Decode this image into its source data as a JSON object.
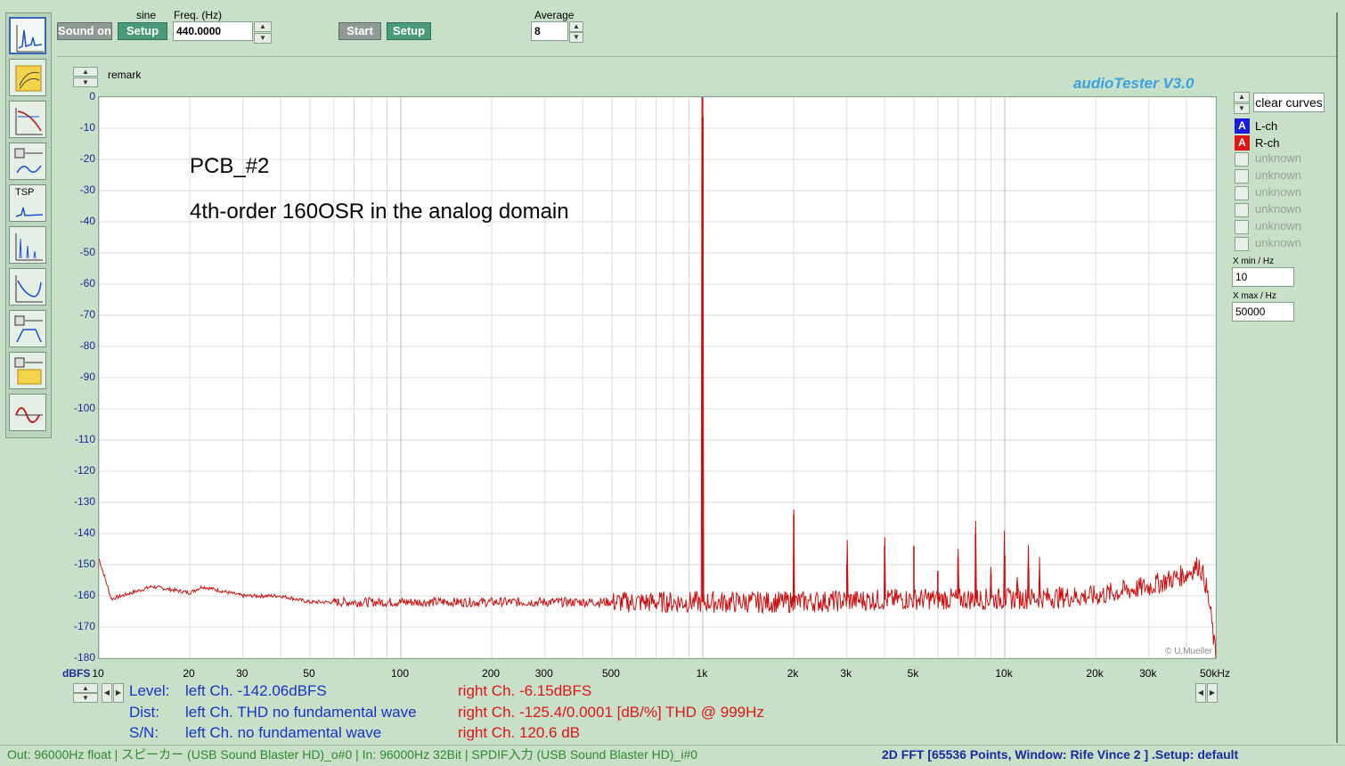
{
  "toolbar": {
    "sound_on": "Sound on",
    "sine_label": "sine",
    "setup1": "Setup",
    "freq_label": "Freq. (Hz)",
    "freq_value": "440.0000",
    "start": "Start",
    "setup2": "Setup",
    "average_label": "Average",
    "average_value": "8"
  },
  "left_tools": [
    {
      "name": "fft-tool-icon"
    },
    {
      "name": "frequency-response-tool-icon"
    },
    {
      "name": "phase-tool-icon"
    },
    {
      "name": "thd-sweep-tool-icon"
    },
    {
      "name": "tsp-tool-icon",
      "label": "TSP"
    },
    {
      "name": "spectrum-tool-icon"
    },
    {
      "name": "impedance-tool-icon"
    },
    {
      "name": "speaker-response-tool-icon"
    },
    {
      "name": "waterfall-tool-icon"
    },
    {
      "name": "oscilloscope-tool-icon"
    }
  ],
  "remark_label": "remark",
  "app_title": "audioTester  V3.0",
  "plot_annotation": {
    "line1": "PCB_#2",
    "line2": "4th-order 160OSR in the analog domain"
  },
  "copyright": "© U.Mueller",
  "right_panel": {
    "clear_curves": "clear curves",
    "channels": [
      {
        "badge": "A",
        "label": "L-ch",
        "color": "#1a1ae0"
      },
      {
        "badge": "A",
        "label": "R-ch",
        "color": "#e01515"
      }
    ],
    "unknown": [
      "unknown",
      "unknown",
      "unknown",
      "unknown",
      "unknown",
      "unknown"
    ],
    "xmin_label": "X min / Hz",
    "xmin_value": "10",
    "xmax_label": "X max / Hz",
    "xmax_value": "50000"
  },
  "info": {
    "level_label": "Level:",
    "level_left": "left Ch. -142.06dBFS",
    "level_right": "right Ch. -6.15dBFS",
    "dist_label": "Dist:",
    "dist_left": "left Ch. THD no fundamental wave",
    "dist_right": "right Ch. -125.4/0.0001 [dB/%] THD @ 999Hz",
    "sn_label": "S/N:",
    "sn_left": "left Ch.  no fundamental wave",
    "sn_right": "right Ch. 120.6 dB"
  },
  "status": {
    "left": "Out: 96000Hz float  | スピーカー (USB Sound Blaster HD)_o#0  | In: 96000Hz 32Bit  | SPDIF入力 (USB Sound Blaster HD)_i#0",
    "right": "2D FFT [65536 Points, Window: Rife Vince 2 ]  .Setup:  default"
  },
  "chart_data": {
    "type": "line",
    "title": "",
    "xlabel": "",
    "ylabel": "dBFS",
    "x_scale": "log",
    "xlim": [
      10,
      50000
    ],
    "ylim": [
      -180,
      0
    ],
    "grid": true,
    "y_ticks": [
      "0",
      "-10",
      "-20",
      "-30",
      "-40",
      "-50",
      "-60",
      "-70",
      "-80",
      "-90",
      "-100",
      "-110",
      "-120",
      "-130",
      "-140",
      "-150",
      "-160",
      "-170",
      "-180"
    ],
    "x_ticks": [
      {
        "v": 10,
        "t": "10"
      },
      {
        "v": 20,
        "t": "20"
      },
      {
        "v": 30,
        "t": "30"
      },
      {
        "v": 50,
        "t": "50"
      },
      {
        "v": 100,
        "t": "100"
      },
      {
        "v": 200,
        "t": "200"
      },
      {
        "v": 300,
        "t": "300"
      },
      {
        "v": 500,
        "t": "500"
      },
      {
        "v": 1000,
        "t": "1k"
      },
      {
        "v": 2000,
        "t": "2k"
      },
      {
        "v": 3000,
        "t": "3k"
      },
      {
        "v": 5000,
        "t": "5k"
      },
      {
        "v": 10000,
        "t": "10k"
      },
      {
        "v": 20000,
        "t": "20k"
      },
      {
        "v": 30000,
        "t": "30k"
      },
      {
        "v": 50000,
        "t": "50kHz"
      }
    ],
    "series": [
      {
        "name": "R-ch",
        "color": "#cc1010",
        "noise_floor": [
          [
            10,
            -148
          ],
          [
            11,
            -161
          ],
          [
            15,
            -157
          ],
          [
            20,
            -159
          ],
          [
            22,
            -157
          ],
          [
            30,
            -160
          ],
          [
            40,
            -160
          ],
          [
            50,
            -162
          ],
          [
            100,
            -162
          ],
          [
            300,
            -162
          ],
          [
            900,
            -162
          ],
          [
            2000,
            -162
          ],
          [
            5000,
            -161
          ],
          [
            10000,
            -161
          ],
          [
            20000,
            -160
          ],
          [
            30000,
            -157
          ],
          [
            40000,
            -153
          ],
          [
            44000,
            -150
          ],
          [
            46000,
            -155
          ],
          [
            48000,
            -165
          ],
          [
            50000,
            -180
          ]
        ],
        "peaks": [
          {
            "f": 999,
            "db": -6.5
          },
          {
            "f": 2000,
            "db": -134
          },
          {
            "f": 3000,
            "db": -150
          },
          {
            "f": 4000,
            "db": -144
          },
          {
            "f": 5000,
            "db": -144
          },
          {
            "f": 6000,
            "db": -152
          },
          {
            "f": 7000,
            "db": -148
          },
          {
            "f": 8000,
            "db": -140
          },
          {
            "f": 9000,
            "db": -153
          },
          {
            "f": 10000,
            "db": -147
          },
          {
            "f": 11000,
            "db": -156
          },
          {
            "f": 12000,
            "db": -151
          },
          {
            "f": 13000,
            "db": -155
          }
        ]
      }
    ]
  }
}
